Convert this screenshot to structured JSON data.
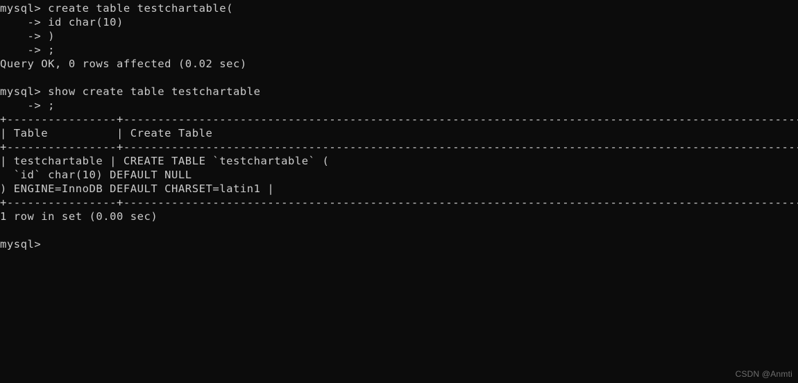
{
  "terminal": {
    "background_color": "#0C0C0C",
    "text_color": "#CCCCCC",
    "watermark_color": "#6E6E6E",
    "watermark": "CSDN @Anmti",
    "prompt": "mysql>",
    "continuation_prompt": "    ->",
    "lines": [
      "mysql> create table testchartable(",
      "    -> id char(10)",
      "    -> )",
      "    -> ;",
      "Query OK, 0 rows affected (0.02 sec)",
      "",
      "mysql> show create table testchartable",
      "    -> ;",
      "+----------------+--------------------------------------------------------------------------------------------------------------------+",
      "| Table          | Create Table                                                                                                       |",
      "+----------------+--------------------------------------------------------------------------------------------------------------------+",
      "| testchartable | CREATE TABLE `testchartable` (",
      "  `id` char(10) DEFAULT NULL",
      ") ENGINE=InnoDB DEFAULT CHARSET=latin1 |",
      "+----------------+--------------------------------------------------------------------------------------------------------------------+",
      "1 row in set (0.00 sec)",
      "",
      "mysql>"
    ]
  }
}
